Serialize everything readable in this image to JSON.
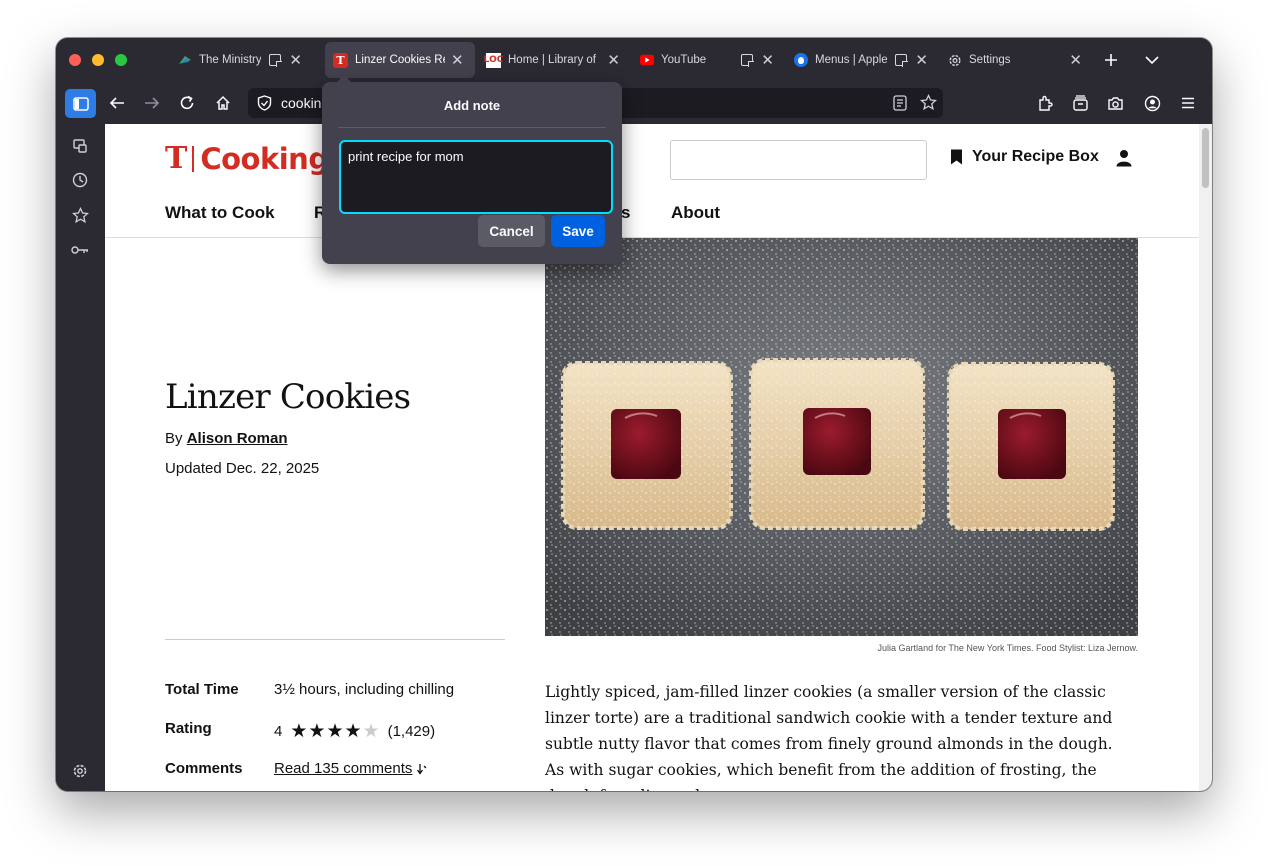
{
  "tabs": [
    {
      "title": "The Ministry of Time",
      "favicon": "ministry-icon"
    },
    {
      "title": "Linzer Cookies Recipe",
      "favicon": "nyt-cooking-icon",
      "active": true
    },
    {
      "title": "Home | Library of Congress",
      "favicon": "loc-icon"
    },
    {
      "title": "YouTube",
      "favicon": "youtube-icon"
    },
    {
      "title": "",
      "favicon": "note-icon"
    },
    {
      "title": "Menus | Apple",
      "favicon": "apple-icon"
    },
    {
      "title": "Settings",
      "favicon": "gear-icon"
    }
  ],
  "urlbar": {
    "value": "cookin"
  },
  "colors": {
    "accent": "#0061e0",
    "brand_red": "#d32c22",
    "focus_ring": "#00ddff"
  },
  "note_popup": {
    "title": "Add note",
    "text": "print recipe for mom",
    "cancel_label": "Cancel",
    "save_label": "Save"
  },
  "site": {
    "logo_t": "T",
    "logo_word": "Cooking",
    "recipe_box_label": "Your Recipe Box",
    "nav": [
      "What to Cook",
      "R",
      "s",
      "About"
    ]
  },
  "recipe": {
    "title": "Linzer Cookies",
    "by_prefix": "By",
    "author": "Alison Roman",
    "updated": "Updated Dec. 22, 2025",
    "total_time_label": "Total Time",
    "total_time": "3½ hours, including chilling",
    "rating_label": "Rating",
    "rating_value": "4",
    "rating_stars": 4,
    "rating_max": 5,
    "rating_count": "(1,429)",
    "comments_label": "Comments",
    "comments_link": "Read 135 comments",
    "photo_credit": "Julia Gartland for The New York Times. Food Stylist: Liza Jernow.",
    "description": "Lightly spiced, jam-filled linzer cookies (a smaller version of the classic linzer torte) are a traditional sandwich cookie with a tender texture and subtle nutty flavor that comes from finely ground almonds in the dough. As with sugar cookies, which benefit from the addition of frosting, the dough for a linzer does"
  }
}
